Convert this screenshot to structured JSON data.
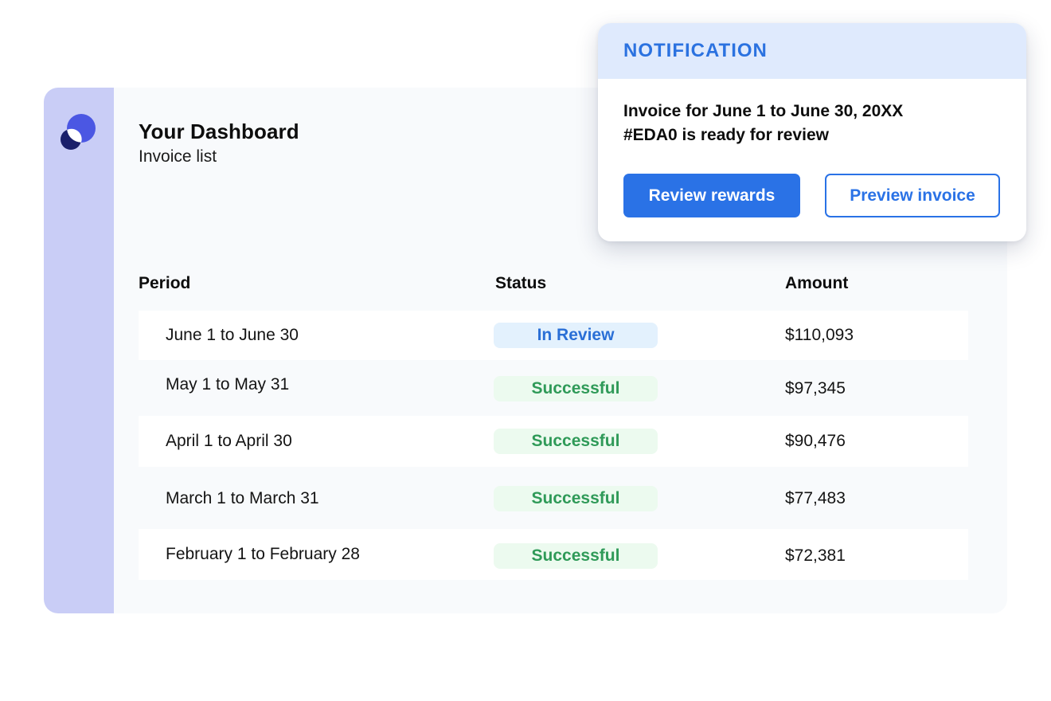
{
  "dashboard": {
    "title": "Your Dashboard",
    "subtitle": "Invoice list"
  },
  "logo": {
    "icon": "overlapping-circles-logo",
    "colors": [
      "#4b57e3",
      "#1a1f6b"
    ]
  },
  "table": {
    "headers": {
      "period": "Period",
      "status": "Status",
      "amount": "Amount"
    },
    "rows": [
      {
        "period": "June 1 to June 30",
        "status": "In Review",
        "status_type": "review",
        "amount": "$110,093"
      },
      {
        "period": "May 1 to May 31",
        "status": "Successful",
        "status_type": "success",
        "amount": "$97,345"
      },
      {
        "period": "April 1 to April 30",
        "status": "Successful",
        "status_type": "success",
        "amount": "$90,476"
      },
      {
        "period": "March 1 to March 31",
        "status": "Successful",
        "status_type": "success",
        "amount": "$77,483"
      },
      {
        "period": "February 1 to February 28",
        "status": "Successful",
        "status_type": "success",
        "amount": "$72,381"
      }
    ]
  },
  "notification": {
    "title": "NOTIFICATION",
    "message_line1": "Invoice for June 1 to June 30, 20XX",
    "message_line2": "#EDA0 is ready for review",
    "primary_button": "Review rewards",
    "secondary_button": "Preview invoice"
  },
  "colors": {
    "sidebar": "#c9cdf6",
    "accent": "#2a72e6",
    "review_badge": "#e3f1fd",
    "success_badge": "#ecfaef",
    "success_text": "#2f9a58"
  }
}
